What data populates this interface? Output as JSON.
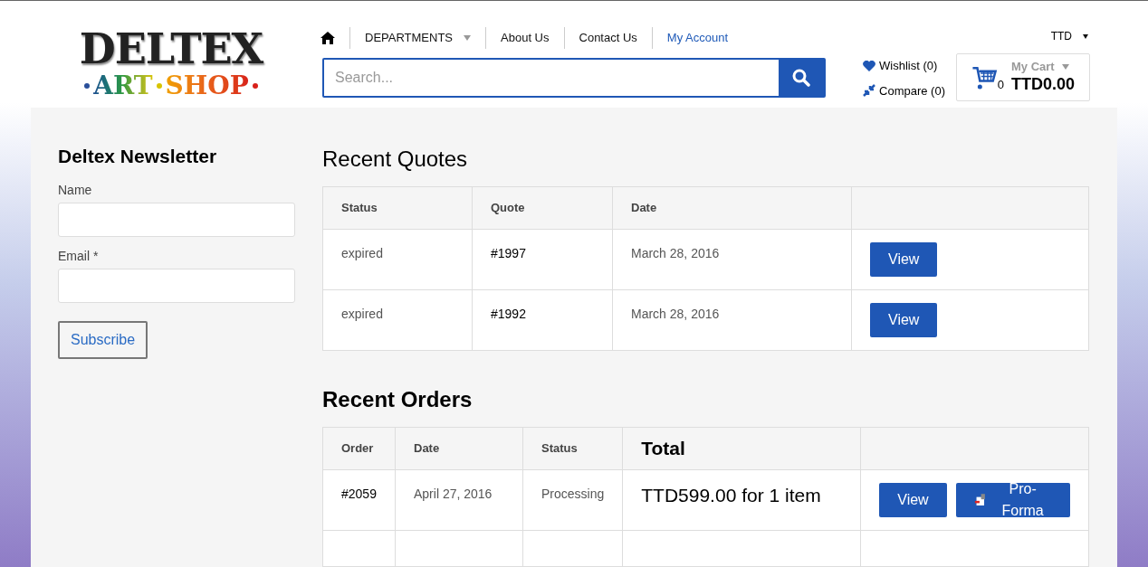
{
  "logo": {
    "line_1": "DELTEX",
    "line_2": "ART",
    "line_3": "SHOP"
  },
  "nav": {
    "items": [
      {
        "label": "DEPARTMENTS",
        "kind": "dropdown",
        "selected": false
      },
      {
        "label": "About Us",
        "kind": "link",
        "selected": false
      },
      {
        "label": "Contact Us",
        "kind": "link",
        "selected": false
      },
      {
        "label": "My Account",
        "kind": "link",
        "selected": true
      }
    ]
  },
  "currency": "TTD",
  "search": {
    "placeholder": "Search..."
  },
  "wishlist": "Wishlist (0)",
  "compare": "Compare (0)",
  "cart": {
    "title": "My Cart",
    "count": "0",
    "total": "TTD0.00"
  },
  "newsletter": {
    "title": "Deltex Newsletter",
    "fields": [
      {
        "label": "Name"
      },
      {
        "label": "Email *"
      }
    ],
    "button": "Subscribe"
  },
  "quotes": {
    "title": "Recent Quotes",
    "columns": [
      "Status",
      "Quote",
      "Date"
    ],
    "rows": [
      {
        "status": "expired",
        "quote": "#1997",
        "date": "March 28, 2016",
        "button": "View"
      },
      {
        "status": "expired",
        "quote": "#1992",
        "date": "March 28, 2016",
        "button": "View"
      }
    ]
  },
  "orders": {
    "title": "Recent Orders",
    "columns": [
      "Order",
      "Date",
      "Status",
      "Total"
    ],
    "rows": [
      {
        "order": "#2059",
        "date": "April 27, 2016",
        "status": "Processing",
        "total": "TTD599.00 for 1 item",
        "buttons": [
          "View",
          "Pro-Forma"
        ]
      }
    ]
  }
}
